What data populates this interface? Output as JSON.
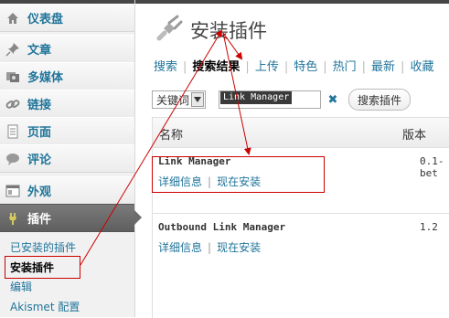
{
  "sidebar": {
    "items": [
      {
        "label": "仪表盘",
        "icon": "dashboard-icon"
      },
      {
        "label": "文章",
        "icon": "pushpin-icon"
      },
      {
        "label": "多媒体",
        "icon": "media-icon"
      },
      {
        "label": "链接",
        "icon": "link-icon"
      },
      {
        "label": "页面",
        "icon": "page-icon"
      },
      {
        "label": "评论",
        "icon": "comment-bubble-icon"
      },
      {
        "label": "外观",
        "icon": "appearance-icon"
      },
      {
        "label": "插件",
        "icon": "plugin-plug-icon"
      }
    ],
    "submenu": [
      "已安装的插件",
      "安装插件",
      "编辑",
      "Akismet 配置"
    ]
  },
  "page": {
    "title": "安装插件",
    "title_icon": "plugin-plug-icon"
  },
  "tabs": [
    "搜索",
    "搜索结果",
    "上传",
    "特色",
    "热门",
    "最新",
    "收藏"
  ],
  "search": {
    "type_value": "关键词",
    "query": "Link Manager",
    "button": "搜索插件"
  },
  "table": {
    "headers": {
      "name": "名称",
      "version": "版本"
    },
    "rows": [
      {
        "name": "Link Manager",
        "version": "0.1-bet",
        "details": "详细信息",
        "install": "现在安装"
      },
      {
        "name": "Outbound Link Manager",
        "version": "1.2",
        "details": "详细信息",
        "install": "现在安装"
      }
    ]
  },
  "colors": {
    "link": "#21759b",
    "annotation": "#cc0000",
    "active_menu": "#6b6b6b"
  }
}
